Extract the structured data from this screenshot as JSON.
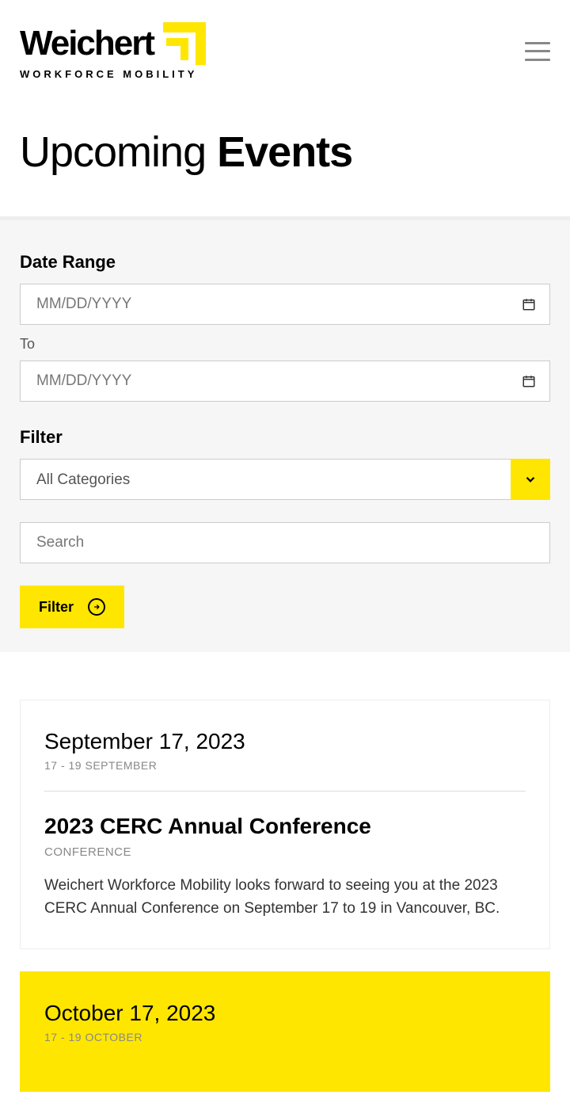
{
  "logo": {
    "text": "Weichert",
    "sub": "WORKFORCE MOBILITY"
  },
  "page": {
    "title_light": "Upcoming ",
    "title_bold": "Events"
  },
  "filter": {
    "date_label": "Date Range",
    "to_label": "To",
    "date_placeholder": "MM/DD/YYYY",
    "filter_label": "Filter",
    "category_selected": "All Categories",
    "search_placeholder": "Search",
    "button_label": "Filter"
  },
  "events": [
    {
      "date": "September 17, 2023",
      "subdate": "17 - 19 SEPTEMBER",
      "title": "2023 CERC Annual Conference",
      "category": "CONFERENCE",
      "desc": "Weichert Workforce Mobility looks forward to seeing you at the 2023 CERC Annual Conference on September 17 to 19 in Vancouver, BC.",
      "highlight": false
    },
    {
      "date": "October 17, 2023",
      "subdate": "17 - 19 OCTOBER",
      "title": "",
      "category": "",
      "desc": "",
      "highlight": true
    }
  ]
}
